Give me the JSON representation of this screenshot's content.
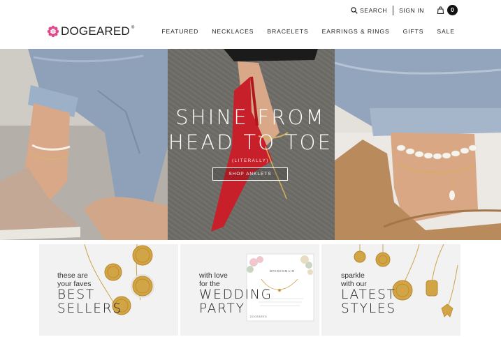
{
  "header": {
    "logo_text": "DOGEARED",
    "logo_reg": "®",
    "search_label": "SEARCH",
    "signin_label": "SIGN IN",
    "cart_count": "0"
  },
  "nav": {
    "items": [
      {
        "label": "FEATURED"
      },
      {
        "label": "NECKLACES"
      },
      {
        "label": "BRACELETS"
      },
      {
        "label": "EARRINGS & RINGS"
      },
      {
        "label": "GIFTS"
      },
      {
        "label": "SALE"
      }
    ]
  },
  "hero": {
    "title_line1": "SHINE FROM",
    "title_line2": "HEAD TO TOE",
    "subtitle": "(LITERALLY)",
    "cta": "SHOP ANKLETS"
  },
  "tiles": [
    {
      "small1": "these are",
      "small2": "your faves",
      "big1": "BEST",
      "big2": "SELLERS"
    },
    {
      "small1": "with love",
      "small2": "for the",
      "big1": "WEDDING",
      "big2": "PARTY",
      "card_title": "BRIDESMAID",
      "card_brand": "DOGEARED"
    },
    {
      "small1": "sparkle",
      "small2": "with our",
      "big1": "LATEST",
      "big2": "STYLES"
    }
  ],
  "colors": {
    "logo_flower": "#e04a8a",
    "text": "#222222",
    "tile_bg": "#f2f2f2",
    "shoe_red": "#c8202a",
    "gold": "#c89a3a"
  }
}
